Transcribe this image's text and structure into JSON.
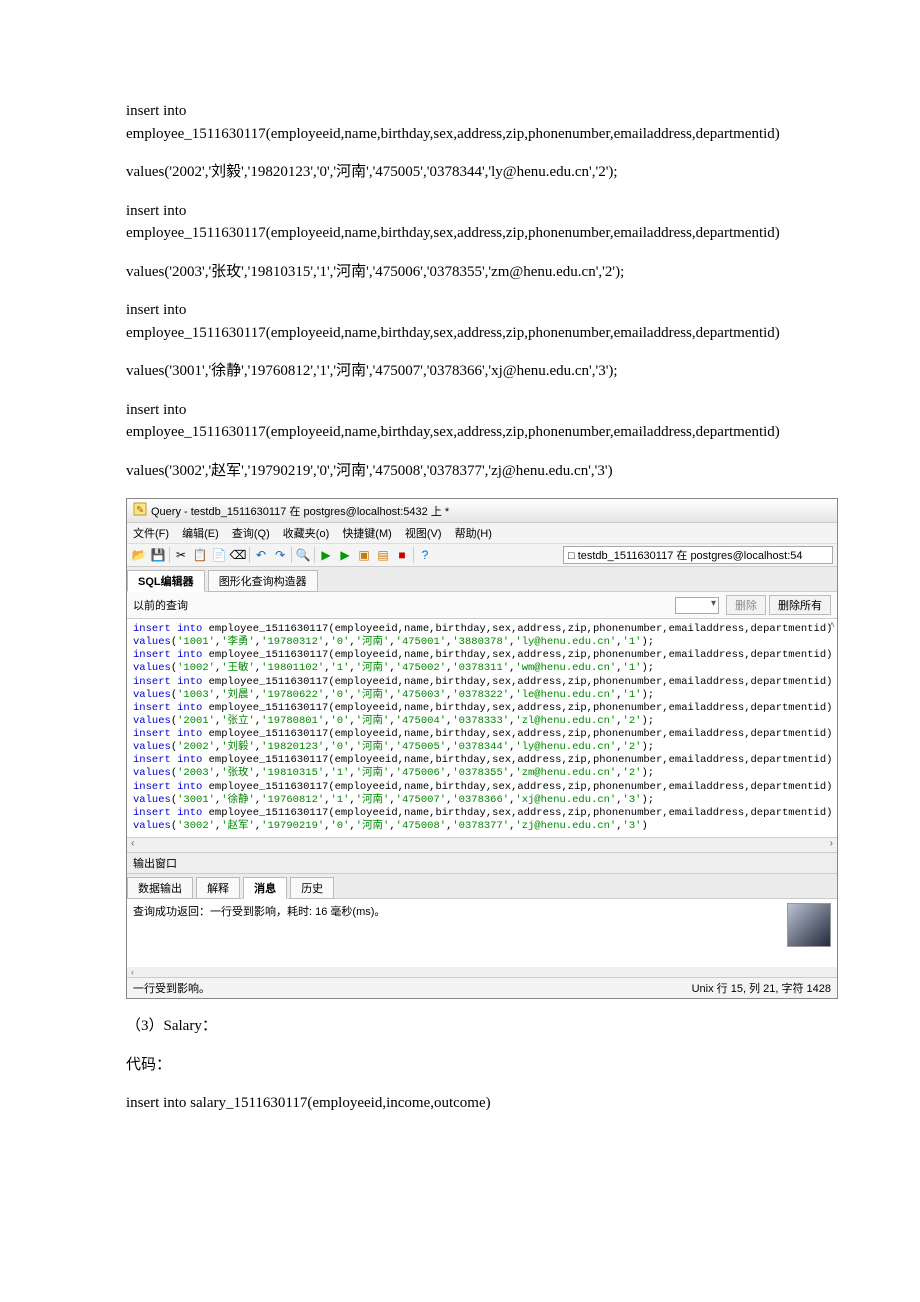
{
  "doc": {
    "p1a": "insert into employee_1511630117(employeeid,name,birthday,sex,address,zip,phonenumber,emailaddress,departmentid)",
    "p1b": "values('2002','刘毅','19820123','0','河南','475005','0378344','ly@henu.edu.cn','2');",
    "p2a": "insert into employee_1511630117(employeeid,name,birthday,sex,address,zip,phonenumber,emailaddress,departmentid)",
    "p2b": "values('2003','张玫','19810315','1','河南','475006','0378355','zm@henu.edu.cn','2');",
    "p3a": "insert into employee_1511630117(employeeid,name,birthday,sex,address,zip,phonenumber,emailaddress,departmentid)",
    "p3b": "values('3001','徐静','19760812','1','河南','475007','0378366','xj@henu.edu.cn','3');",
    "p4a": "insert into employee_1511630117(employeeid,name,birthday,sex,address,zip,phonenumber,emailaddress,departmentid)",
    "p4b": "values('3002','赵军','19790219','0','河南','475008','0378377','zj@henu.edu.cn','3')",
    "after1": "（3）Salary：",
    "after2": "代码：",
    "after3": "insert into salary_1511630117(employeeid,income,outcome)"
  },
  "app": {
    "title": "Query - testdb_1511630117 在 postgres@localhost:5432 上 *",
    "menu": [
      "文件(F)",
      "编辑(E)",
      "查询(Q)",
      "收藏夹(o)",
      "快捷键(M)",
      "视图(V)",
      "帮助(H)"
    ],
    "db_selector": "□ testdb_1511630117 在 postgres@localhost:54",
    "tabs": {
      "sql": "SQL编辑器",
      "gfx": "图形化查询构造器"
    },
    "prevRow": {
      "label": "以前的查询",
      "delete": "删除",
      "deleteAll": "删除所有"
    },
    "outputPane": "输出窗口",
    "outTabs": [
      "数据输出",
      "解释",
      "消息",
      "历史"
    ],
    "outMsg": "查询成功返回：一行受到影响，耗时: 16 毫秒(ms)。",
    "statusLeft": "一行受到影响。",
    "statusRight": "Unix   行 15, 列 21, 字符 1428"
  },
  "sql": {
    "rows": [
      {
        "id": "1001",
        "name": "李勇",
        "bd": "19780312",
        "sex": "0",
        "addr": "河南",
        "zip": "475001",
        "ph": "3880378",
        "em": "ly@henu.edu.cn",
        "dep": "1"
      },
      {
        "id": "1002",
        "name": "王敏",
        "bd": "19801102",
        "sex": "1",
        "addr": "河南",
        "zip": "475002",
        "ph": "0378311",
        "em": "wm@henu.edu.cn",
        "dep": "1"
      },
      {
        "id": "1003",
        "name": "刘晨",
        "bd": "19780622",
        "sex": "0",
        "addr": "河南",
        "zip": "475003",
        "ph": "0378322",
        "em": "le@henu.edu.cn",
        "dep": "1"
      },
      {
        "id": "2001",
        "name": "张立",
        "bd": "19780801",
        "sex": "0",
        "addr": "河南",
        "zip": "475004",
        "ph": "0378333",
        "em": "zl@henu.edu.cn",
        "dep": "2"
      },
      {
        "id": "2002",
        "name": "刘毅",
        "bd": "19820123",
        "sex": "0",
        "addr": "河南",
        "zip": "475005",
        "ph": "0378344",
        "em": "ly@henu.edu.cn",
        "dep": "2"
      },
      {
        "id": "2003",
        "name": "张玫",
        "bd": "19810315",
        "sex": "1",
        "addr": "河南",
        "zip": "475006",
        "ph": "0378355",
        "em": "zm@henu.edu.cn",
        "dep": "2"
      },
      {
        "id": "3001",
        "name": "徐静",
        "bd": "19760812",
        "sex": "1",
        "addr": "河南",
        "zip": "475007",
        "ph": "0378366",
        "em": "xj@henu.edu.cn",
        "dep": "3"
      },
      {
        "id": "3002",
        "name": "赵军",
        "bd": "19790219",
        "sex": "0",
        "addr": "河南",
        "zip": "475008",
        "ph": "0378377",
        "em": "zj@henu.edu.cn",
        "dep": "3"
      }
    ]
  }
}
